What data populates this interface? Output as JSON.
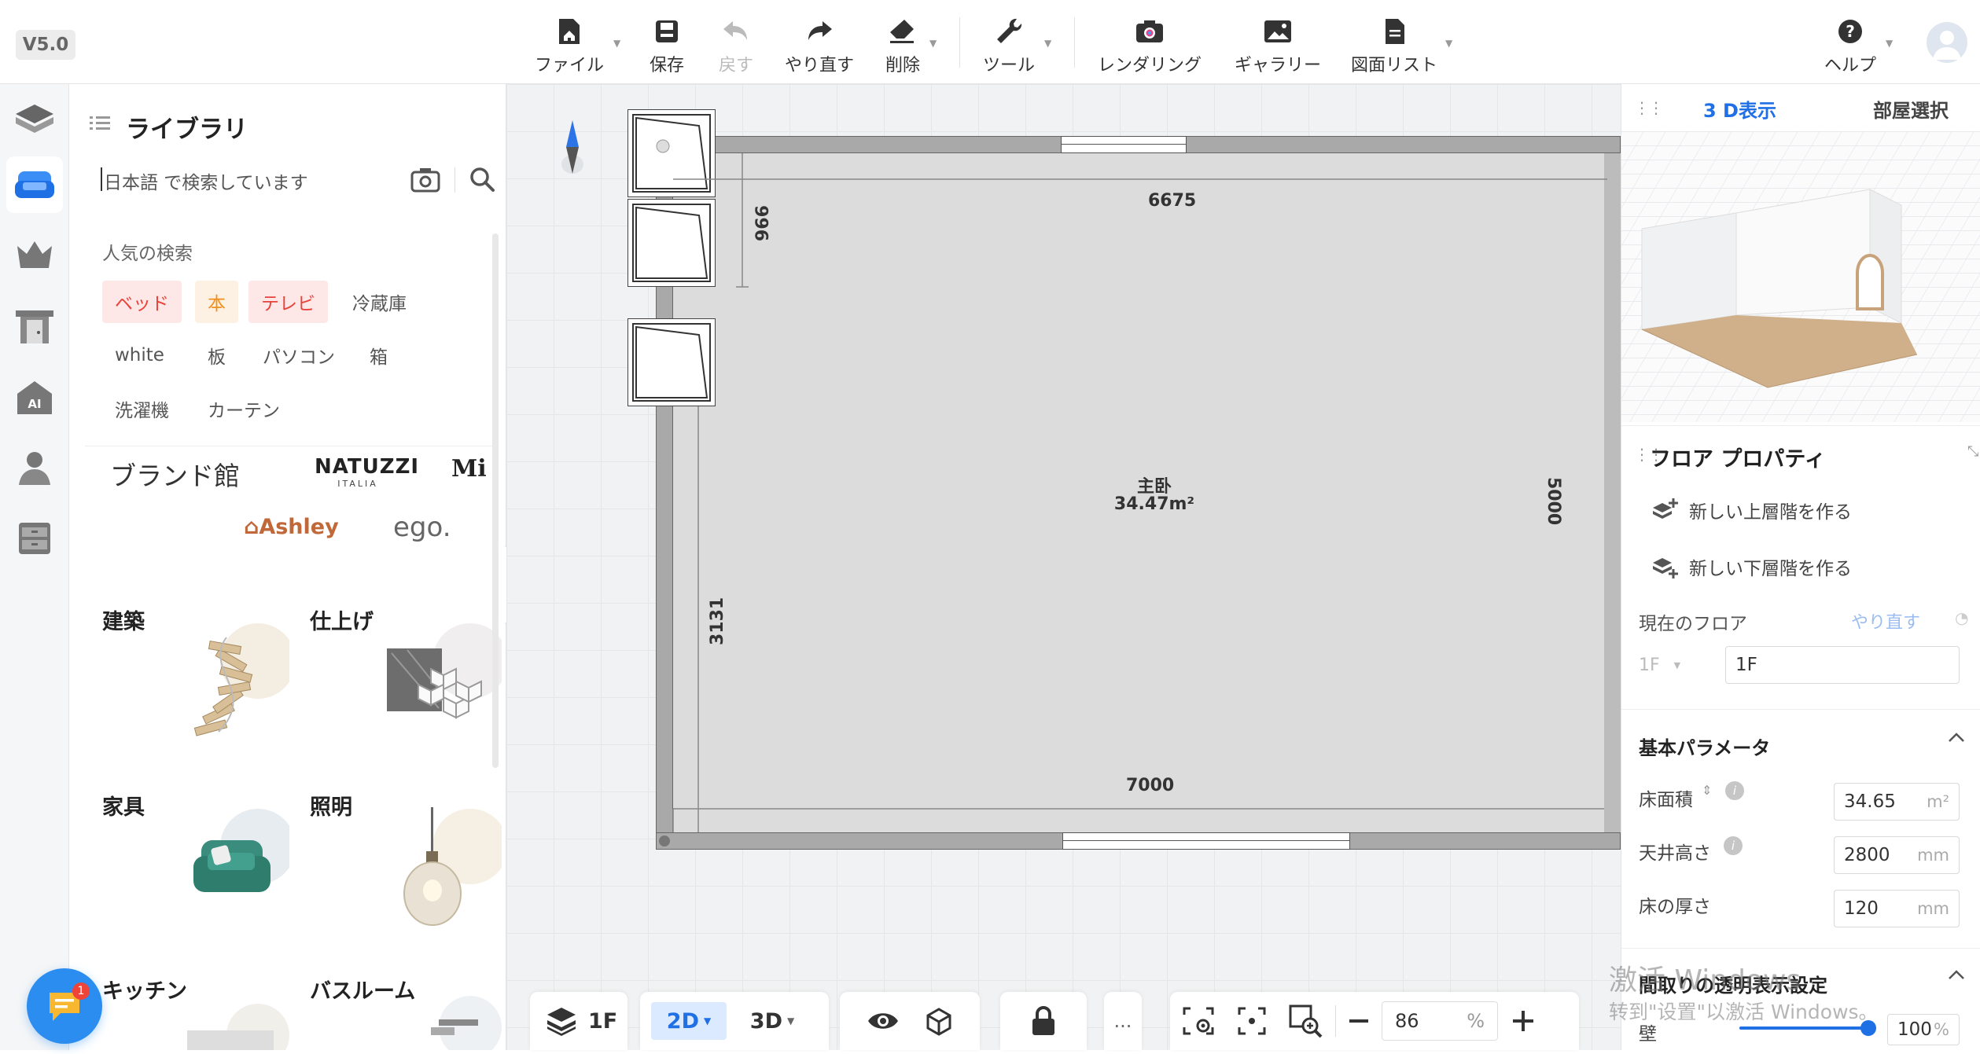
{
  "app": {
    "version": "V5.0"
  },
  "toolbar": {
    "file": "ファイル",
    "save": "保存",
    "undo": "戻す",
    "redo": "やり直す",
    "delete": "削除",
    "tools": "ツール",
    "rendering": "レンダリング",
    "gallery": "ギャラリー",
    "drawing_list": "図面リスト",
    "help": "ヘルプ"
  },
  "library": {
    "title": "ライブラリ",
    "search_placeholder": "日本語 で検索しています",
    "popular_title": "人気の検索",
    "popular_tags": [
      "ベッド",
      "本",
      "テレビ",
      "冷蔵庫",
      "white",
      "板",
      "パソコン",
      "箱",
      "洗濯機",
      "カーテン"
    ],
    "brand_title": "ブランド館",
    "brands": [
      "NATUZZI",
      "ITALIA",
      "Mi",
      "Ashley",
      "ego."
    ],
    "categories": [
      "建築",
      "仕上げ",
      "家具",
      "照明",
      "キッチン",
      "バスルーム"
    ]
  },
  "floorplan": {
    "room_name": "主卧",
    "room_area": "34.47m²",
    "dimensions": [
      "6675",
      "966",
      "5000",
      "3131",
      "7000"
    ]
  },
  "right_panel": {
    "tabs": [
      "3 D表示",
      "部屋選択"
    ],
    "floor_props_title": "フロア プロパティ",
    "add_upper": "新しい上層階を作る",
    "add_lower": "新しい下層階を作る",
    "current_floor_label": "現在のフロア",
    "redo_link": "やり直す",
    "floor_select": "1F",
    "floor_name": "1F",
    "basic_params_title": "基本パラメータ",
    "floor_area_label": "床面積",
    "floor_area_value": "34.65",
    "floor_area_unit": "m²",
    "ceiling_label": "天井高さ",
    "ceiling_value": "2800",
    "ceiling_unit": "mm",
    "thickness_label": "床の厚さ",
    "thickness_value": "120",
    "thickness_unit": "mm",
    "transparency_title": "間取りの透明表示設定",
    "wall_label": "壁",
    "wall_value": "100",
    "wall_unit": "%"
  },
  "bottom_bar": {
    "floor": "1F",
    "view2d": "2D",
    "view3d": "3D",
    "more": "...",
    "zoom": "86",
    "zoom_unit": "%"
  },
  "watermark": {
    "line1": "激活 Windows",
    "line2": "转到\"设置\"以激活 Windows。"
  },
  "chat": {
    "badge": "1"
  }
}
